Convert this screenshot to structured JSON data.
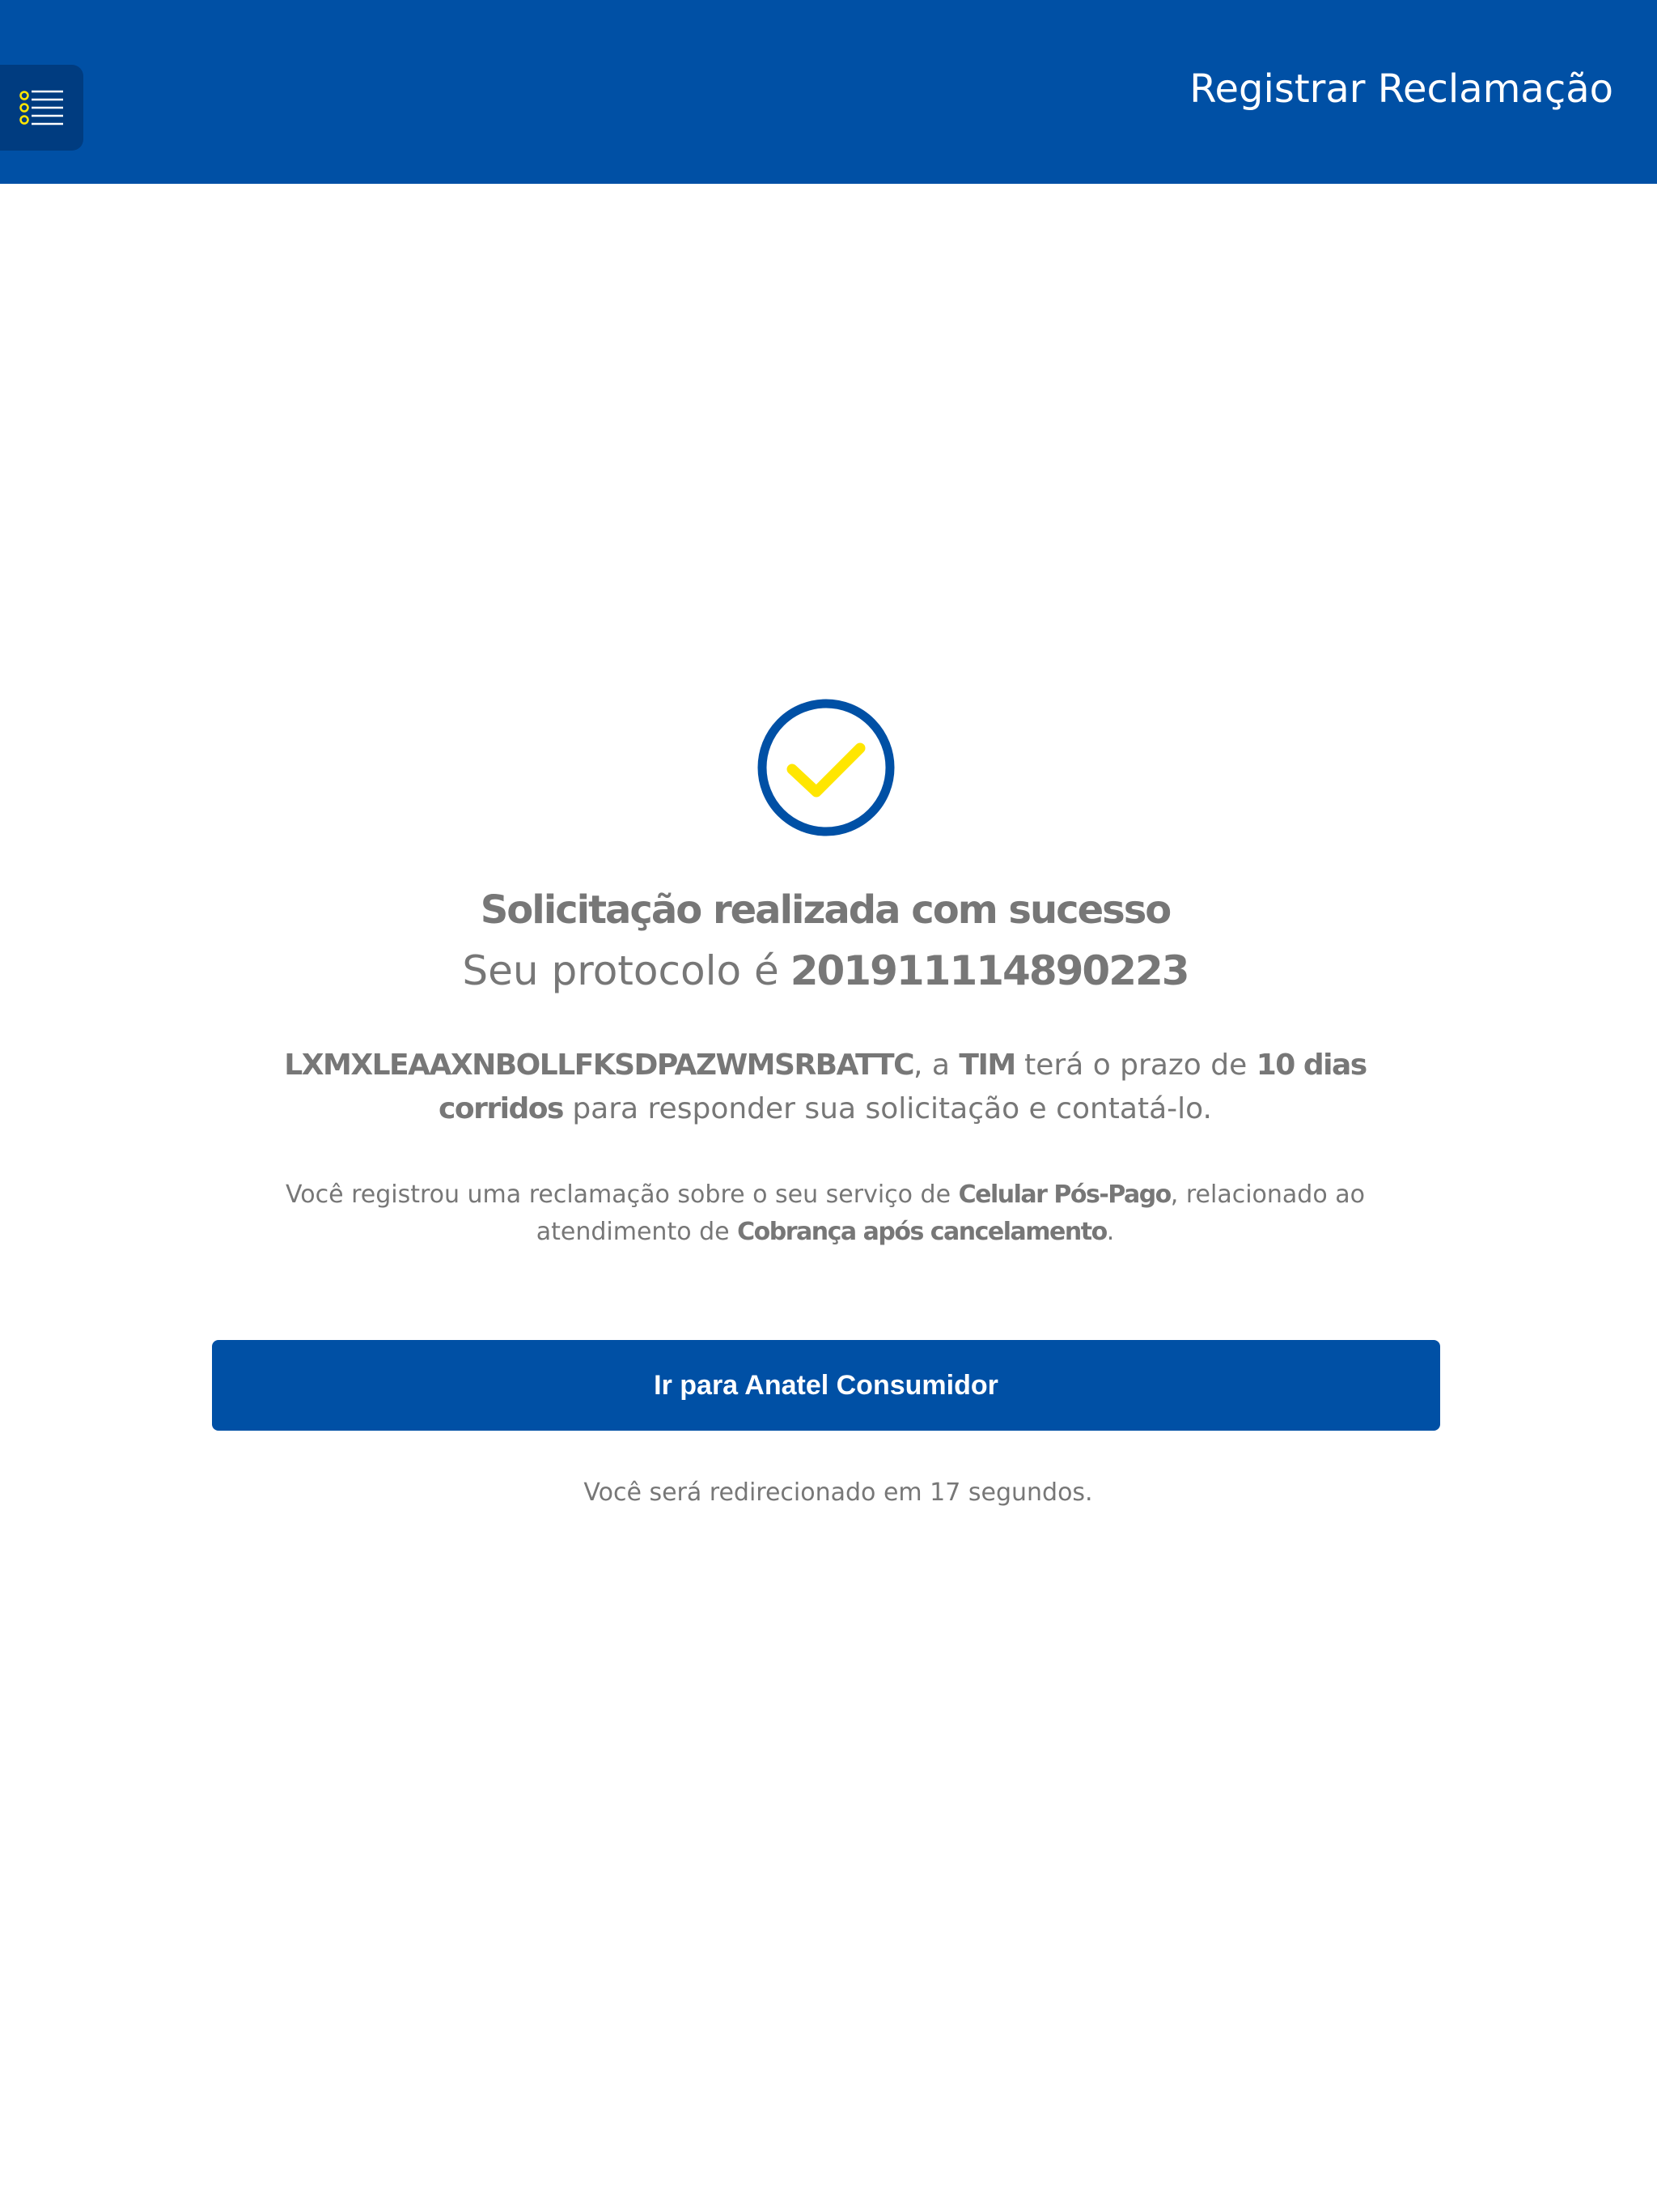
{
  "header": {
    "title": "Registrar Reclamação",
    "menu_icon": "list-menu-icon"
  },
  "colors": {
    "brand_blue": "#0050a5",
    "menu_button": "#003c80",
    "accent_yellow": "#ffe600",
    "text_gray": "#777777"
  },
  "success": {
    "icon": "check-circle-icon",
    "title": "Solicitação realizada com sucesso",
    "protocol_label": "Seu protocolo é",
    "protocol_number": "201911114890223"
  },
  "deadline": {
    "name": "LXMXLEAAXNBOLLFKSDPAZWMSRBATTC",
    "text_1": ", a ",
    "company": "TIM",
    "text_2": " terá o prazo de ",
    "period": "10 dias corridos",
    "text_3": " para responder sua solicitação e contatá-lo."
  },
  "service": {
    "text_1": "Você registrou uma reclamação sobre o seu serviço de ",
    "service_type": "Celular Pós-Pago",
    "text_2": ", relacionado ao atendimento de ",
    "subject": "Cobrança após cancelamento",
    "text_3": "."
  },
  "action": {
    "button_label": "Ir para Anatel Consumidor"
  },
  "redirect": {
    "text": "Você será redirecionado em 17 segundos."
  }
}
